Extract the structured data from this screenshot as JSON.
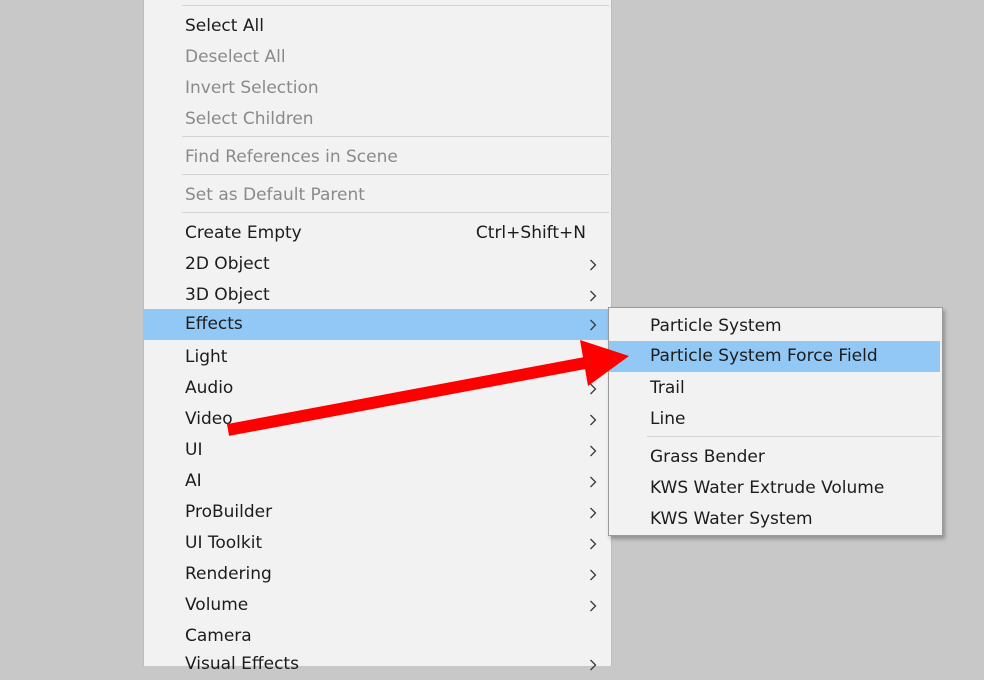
{
  "main_menu": {
    "items": [
      {
        "label": "Select All",
        "disabled": false
      },
      {
        "label": "Deselect All",
        "disabled": true
      },
      {
        "label": "Invert Selection",
        "disabled": true
      },
      {
        "label": "Select Children",
        "disabled": true
      },
      {
        "label": "Find References in Scene",
        "disabled": true
      },
      {
        "label": "Set as Default Parent",
        "disabled": true
      },
      {
        "label": "Create Empty",
        "shortcut": "Ctrl+Shift+N"
      },
      {
        "label": "2D Object",
        "submenu": true
      },
      {
        "label": "3D Object",
        "submenu": true
      },
      {
        "label": "Effects",
        "submenu": true,
        "highlighted": true
      },
      {
        "label": "Light",
        "submenu": true
      },
      {
        "label": "Audio",
        "submenu": true
      },
      {
        "label": "Video",
        "submenu": true
      },
      {
        "label": "UI",
        "submenu": true
      },
      {
        "label": "AI",
        "submenu": true
      },
      {
        "label": "ProBuilder",
        "submenu": true
      },
      {
        "label": "UI Toolkit",
        "submenu": true
      },
      {
        "label": "Rendering",
        "submenu": true
      },
      {
        "label": "Volume",
        "submenu": true
      },
      {
        "label": "Camera"
      },
      {
        "label": "Visual Effects",
        "submenu": true
      }
    ]
  },
  "effects_submenu": {
    "items": [
      {
        "label": "Particle System"
      },
      {
        "label": "Particle System Force Field",
        "highlighted": true
      },
      {
        "label": "Trail"
      },
      {
        "label": "Line"
      },
      {
        "label": "Grass Bender"
      },
      {
        "label": "KWS Water Extrude Volume"
      },
      {
        "label": "KWS Water System"
      }
    ]
  },
  "annotation": {
    "type": "arrow",
    "color": "#ff0000"
  },
  "colors": {
    "background": "#c8c8c8",
    "menu_background": "#f2f2f2",
    "highlight": "#91c8f6",
    "disabled_text": "#8a8a8a"
  }
}
